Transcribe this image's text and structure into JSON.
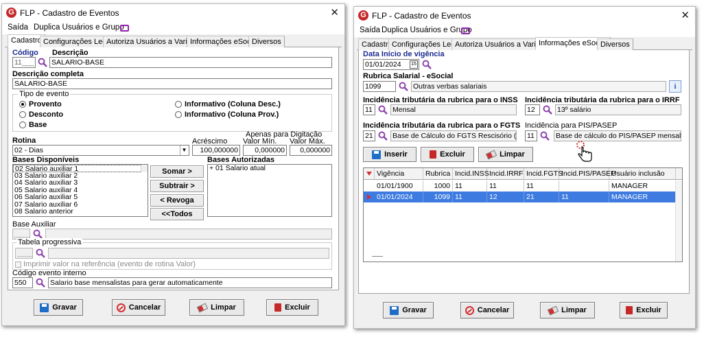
{
  "window": {
    "title": "FLP - Cadastro de Eventos"
  },
  "menu": {
    "exit": "Saída",
    "duplicate": "Duplica Usuários e Grupo"
  },
  "tabs": [
    "Cadastro",
    "Configurações Legais",
    "Autoriza Usuários a Variáveis",
    "Informações eSocial",
    "Diversos"
  ],
  "left": {
    "active_tab": "Cadastro",
    "codigo_label": "Código",
    "codigo_value": "11___",
    "descricao_label": "Descrição",
    "descricao_value": "SALARIO-BASE",
    "desc_completa_label": "Descrição completa",
    "desc_completa_value": "SALARIO-BASE",
    "tipo_evento_label": "Tipo de evento",
    "tipo_options": [
      "Provento",
      "Desconto",
      "Base",
      "Informativo (Coluna Desc.)",
      "Informativo (Coluna Prov.)"
    ],
    "tipo_selected": "Provento",
    "rotina_label": "Rotina",
    "rotina_value": "02 - Dias",
    "acrescimo_label": "Acréscimo",
    "acrescimo_value": "100,000000",
    "apenas_label": "Apenas para Digitação",
    "valor_min_label": "Valor Mín.",
    "valor_min_value": "0,000000",
    "valor_max_label": "Valor Máx.",
    "valor_max_value": "0,000000",
    "bases_disp_label": "Bases Disponíveis",
    "bases_disp": [
      "02 Salario auxiliar 1",
      "03 Salario auxiliar 2",
      "04 Salario auxiliar 3",
      "05 Salario auxiliar 4",
      "06 Salario auxiliar 5",
      "07 Salario auxiliar 6",
      "08 Salario anterior"
    ],
    "bases_aut_label": "Bases Autorizadas",
    "bases_aut": [
      "+ 01 Salario atual"
    ],
    "btn_somar": "Somar >",
    "btn_subtrair": "Subtrair >",
    "btn_revoga": "< Revoga",
    "btn_todos": "<<Todos",
    "base_aux_label": "Base Auxiliar",
    "base_aux_value": "____",
    "tabela_label": "Tabela progressiva",
    "tabela_value": "____",
    "imprimir_label": "Imprimir valor na referência (evento de rotina Valor)",
    "cod_interno_label": "Código evento interno",
    "cod_interno_value": "550",
    "cod_interno_desc": "Salario base mensalistas para gerar automaticamente"
  },
  "right": {
    "active_tab": "Informações eSocial",
    "data_inicio_label": "Data Início de vigência",
    "data_inicio_value": "01/01/2024",
    "calendar_day": "15",
    "rubrica_label": "Rubrica Salarial - eSocial",
    "rubrica_code": "1099",
    "rubrica_desc": "Outras verbas salariais",
    "inss_label": "Incidência tributária da rubrica para o INSS",
    "inss_code": "11",
    "inss_desc": "Mensal",
    "irrf_label": "Incidência tributária da rubrica para o IRRF",
    "irrf_code": "12",
    "irrf_desc": "13º salário",
    "fgts_label": "Incidência tributária da rubrica para o FGTS",
    "fgts_code": "21",
    "fgts_desc": "Base de Cálculo do FGTS  Rescisório (aviso pr",
    "pis_label": "Incidência para PIS/PASEP",
    "pis_code": "11",
    "pis_desc": "Base de cálculo do PIS/PASEP mensal",
    "btn_inserir": "Inserir",
    "btn_excluir": "Excluir",
    "btn_limpar": "Limpar",
    "grid": {
      "headers": [
        "Vigência",
        "Rubrica",
        "Incid.INSS",
        "Incid.IRRF",
        "Incid.FGTS",
        "Incid.PIS/PASEP",
        "Usuário inclusão"
      ],
      "rows": [
        [
          "01/01/1900",
          "1000",
          "11",
          "11",
          "11",
          "",
          "MANAGER"
        ],
        [
          "01/01/2024",
          "1099",
          "11",
          "12",
          "21",
          "11",
          "MANAGER"
        ]
      ]
    }
  },
  "footer": {
    "gravar": "Gravar",
    "cancelar": "Cancelar",
    "limpar": "Limpar",
    "excluir": "Excluir"
  },
  "colors": {
    "label_blue": "#1a2a8f",
    "selection": "#3d7be0",
    "accent_red": "#d32f2f"
  }
}
